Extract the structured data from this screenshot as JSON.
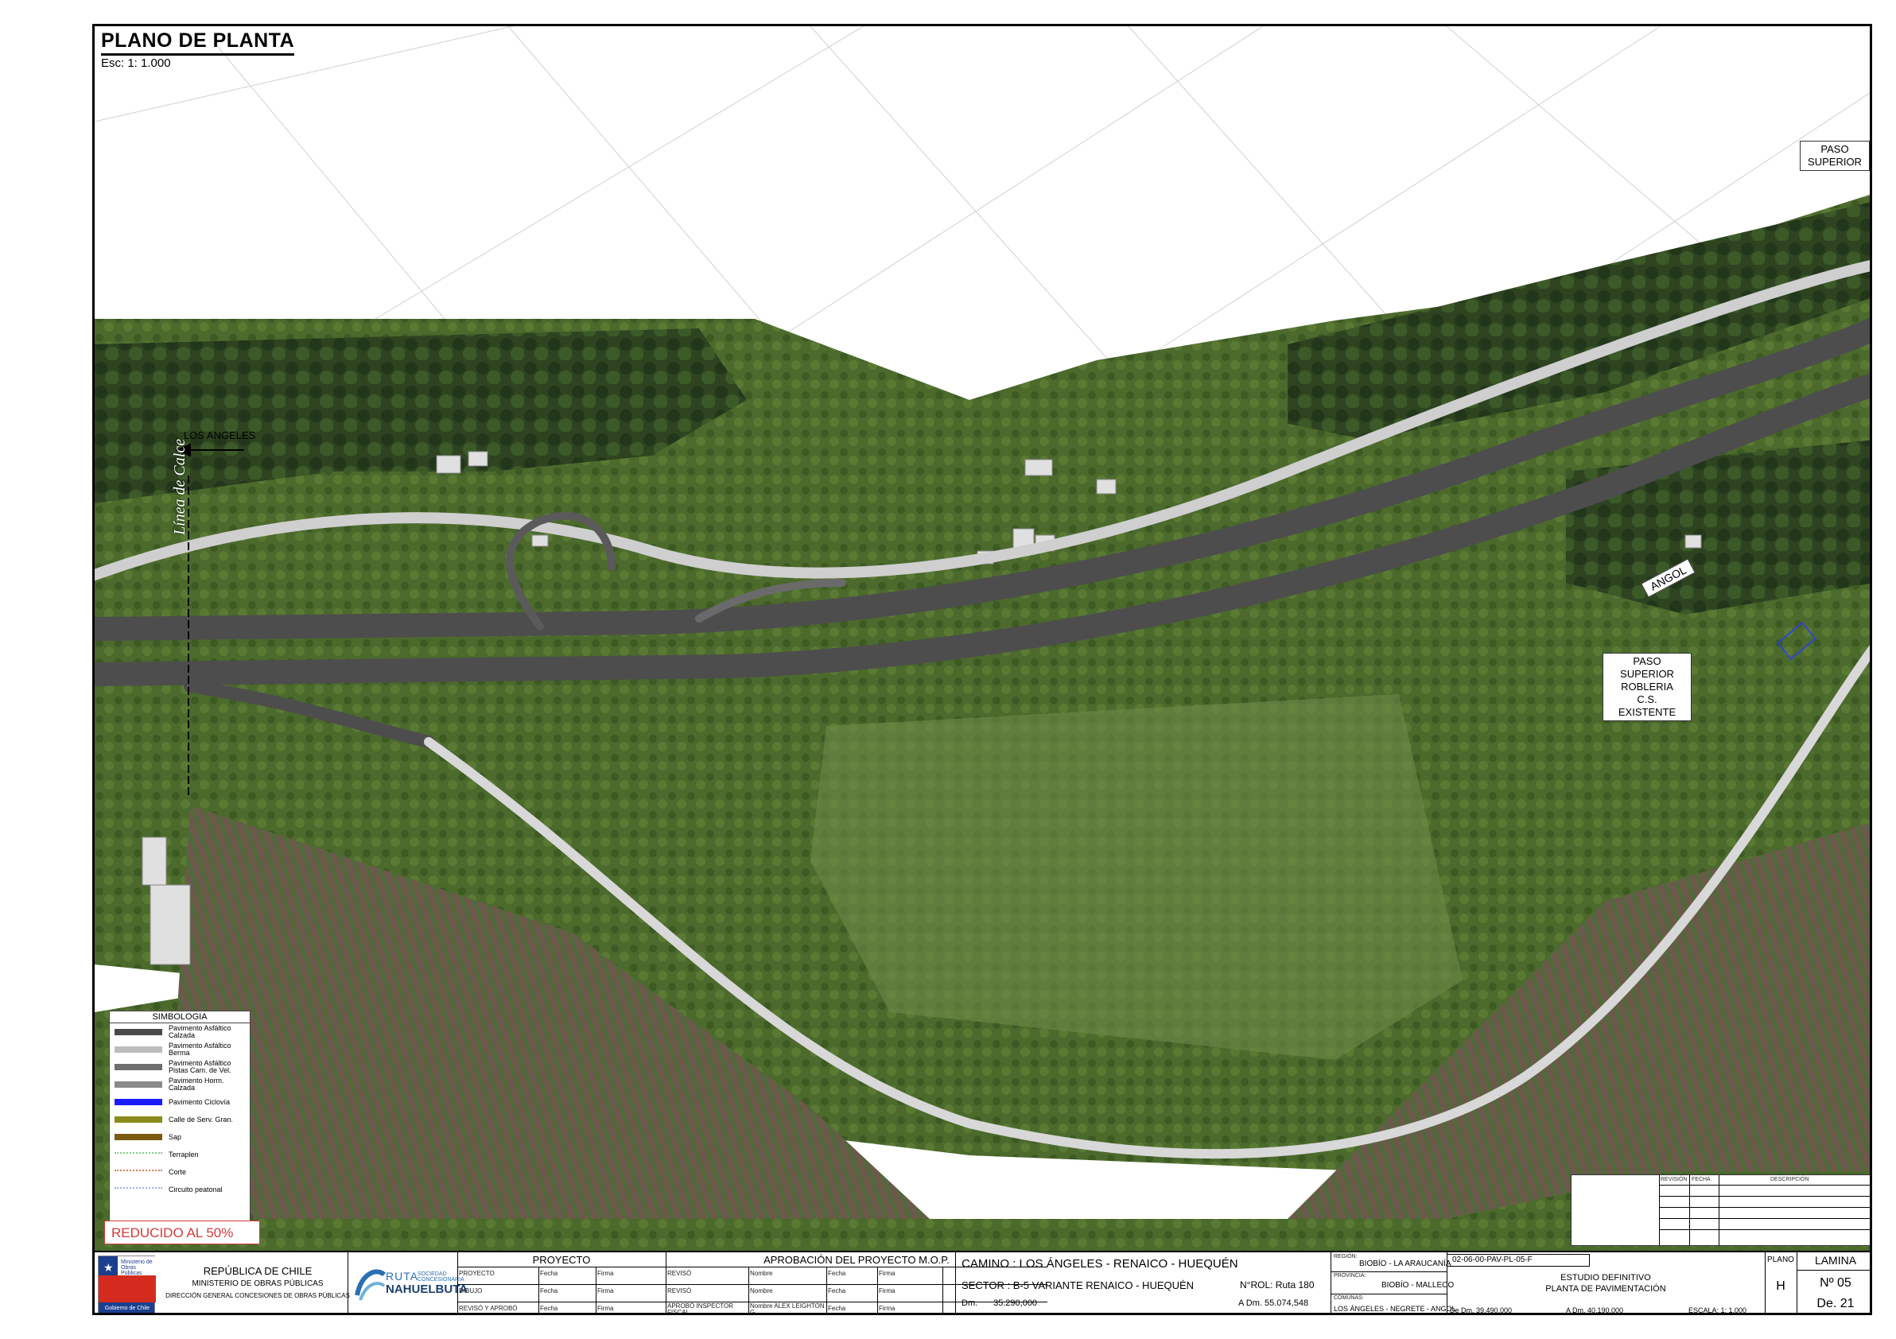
{
  "plan": {
    "title": "PLANO DE PLANTA",
    "scale": "Esc: 1: 1.000"
  },
  "map_labels": {
    "paso_superior_top": "PASO SUPERIOR",
    "los_angeles": "LOS ANGELES",
    "linea_calce": "Línea de Calce",
    "angol": "ANGOL",
    "paso_robleria": [
      "PASO SUPERIOR",
      "ROBLERIA",
      "C.S. EXISTENTE"
    ]
  },
  "legend": {
    "title": "SIMBOLOGIA",
    "items": [
      {
        "label": "Pavimento Asfáltico Calzada",
        "color": "#4a4a4a"
      },
      {
        "label": "Pavimento Asfáltico Berma",
        "color": "#bdbdbd"
      },
      {
        "label": "Pavimento Asfáltico Pistas Cam. de Vel.",
        "color": "#6e6e6e"
      },
      {
        "label": "Pavimento Horm. Calzada",
        "color": "#8a8a8a"
      },
      {
        "label": "Pavimento Ciclovía",
        "color": "#1a1aff"
      },
      {
        "label": "Calle de Serv. Gran.",
        "color": "#8a8a1a"
      },
      {
        "label": "Sap",
        "color": "#7a5a10"
      },
      {
        "label": "Terraplen",
        "color": "#7ed17e"
      },
      {
        "label": "Corte",
        "color": "#e07a5a"
      },
      {
        "label": "Circuito peatonal",
        "color": "#9ab8e0"
      }
    ]
  },
  "reducido": "REDUCIDO AL 50%",
  "revisions": {
    "headers": [
      "REVISIÓN",
      "FECHA",
      "DESCRIPCIÓN"
    ]
  },
  "cartouche": {
    "republic": "REPÚBLICA DE CHILE",
    "ministry": "MINISTERIO DE OBRAS PÚBLICAS",
    "direction": "DIRECCIÓN GENERAL CONCESIONES DE OBRAS PÚBLICAS",
    "logo_small": "Ministerio de Obras Públicas",
    "logo_bottom": "Gobierno de Chile",
    "ruta_top": "RUTA",
    "ruta_name": "NAHUELBUTA",
    "ruta_tag": "SOCIEDAD CONCESIONARIA",
    "proyecto": {
      "header": "PROYECTO",
      "rows": [
        {
          "role": "PROYECTO",
          "c1": "Fecha",
          "c2": "Firma"
        },
        {
          "role": "DIBUJO",
          "c1": "Fecha",
          "c2": "Firma"
        },
        {
          "role": "REVISÓ Y APROBÓ",
          "c1": "Fecha",
          "c2": "Firma"
        }
      ]
    },
    "aprobacion": {
      "header": "APROBACIÓN DEL PROYECTO M.O.P.",
      "rows": [
        {
          "role": "REVISÓ",
          "c1": "Nombre",
          "c2": "Fecha",
          "c3": "Firma"
        },
        {
          "role": "REVISÓ",
          "c1": "Nombre",
          "c2": "Fecha",
          "c3": "Firma"
        },
        {
          "role": "APROBÓ INSPECTOR FISCAL",
          "c1": "Nombre ALEX LEIGHTON G.",
          "c2": "Fecha",
          "c3": "Firma"
        }
      ]
    },
    "camino": "CAMINO : LOS ÁNGELES - RENAICO - HUEQUÉN",
    "sector": "SECTOR : B-5 VARIANTE RENAICO - HUEQUÉN",
    "nrol": "N°ROL: Ruta 180",
    "dm_label": "Dm.",
    "dm_value": "35.290,000",
    "adm": "A Dm.  55.074,548",
    "region_label": "REGIÓN:",
    "region": "BIOBÍO - LA ARAUCANÍA",
    "provincia_label": "PROVINCIA:",
    "provincia": "BIOBÍO - MALLECO",
    "comunas_label": "COMUNAS:",
    "comunas": "LOS ÁNGELES - NEGRETE - ANGOL",
    "code": "02-06-00-PAV-PL-05-F",
    "estudio": "ESTUDIO DEFINITIVO",
    "planta": "PLANTA DE PAVIMENTACIÓN",
    "de_dm": "De Dm. 39.490,000",
    "a_dm": "A Dm. 40.190,000",
    "escala": "ESCALA:  1: 1.000",
    "plano_label": "PLANO",
    "plano_value": "H",
    "lamina_label": "LAMINA",
    "lamina_no": "Nº   05",
    "lamina_de": "De. 21"
  }
}
